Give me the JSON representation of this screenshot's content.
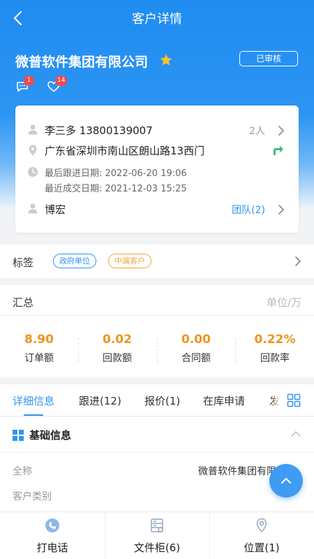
{
  "nav": {
    "title": "客户详情"
  },
  "company": {
    "name": "微普软件集团有限公司",
    "status_badge": "已审核",
    "messages_count": "1",
    "likes_count": "14"
  },
  "contact": {
    "name_phone": "李三多  13800139007",
    "people_count": "2人",
    "address": "广东省深圳市南山区朗山路13西门",
    "last_follow": "最后跟进日期:   2022-06-20 19:06",
    "last_deal": "最近成交日期:   2021-12-03 15:25",
    "owner": "博宏",
    "team_link": "团队(2)"
  },
  "tags": {
    "label": "标签",
    "items": [
      "政府单位",
      "中端客户"
    ]
  },
  "summary": {
    "title": "汇总",
    "unit": "单位/万",
    "stats": [
      {
        "value": "8.90",
        "label": "订单额"
      },
      {
        "value": "0.02",
        "label": "回款额"
      },
      {
        "value": "0.00",
        "label": "合同额"
      },
      {
        "value": "0.22%",
        "label": "回款率"
      }
    ]
  },
  "tabs": [
    "详细信息",
    "跟进(12)",
    "报价(1)",
    "在库申请",
    "发"
  ],
  "detail": {
    "section_title": "基础信息",
    "fields": [
      {
        "label": "全称",
        "value": "微普软件集团有限公司"
      },
      {
        "label": "客户类别",
        "value": ""
      }
    ]
  },
  "bottom_bar": [
    "打电话",
    "文件柜(6)",
    "位置(1)"
  ],
  "colors": {
    "primary": "#2d95f3",
    "accent_orange": "#f0931e",
    "badge_red": "#f5484b",
    "success_green": "#3fbf7f"
  }
}
